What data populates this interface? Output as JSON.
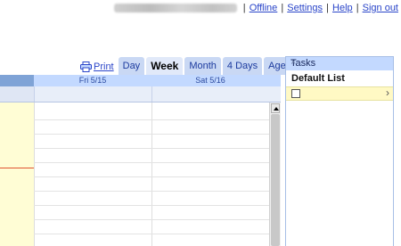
{
  "toplinks": {
    "offline": "Offline",
    "settings": "Settings",
    "help": "Help",
    "signout": "Sign out",
    "separator": "|"
  },
  "viewbar": {
    "print": "Print",
    "tabs": [
      {
        "label": "Day"
      },
      {
        "label": "Week",
        "active": true
      },
      {
        "label": "Month"
      },
      {
        "label": "4 Days"
      },
      {
        "label": "Agenda"
      }
    ]
  },
  "calendar": {
    "days": [
      "Fri 5/15",
      "Sat 5/16"
    ]
  },
  "tasks": {
    "title": "Tasks",
    "close": "×",
    "list_name": "Default List",
    "chevron": "›"
  },
  "colors": {
    "link": "#2a45c9",
    "header_blue": "#c3d9ff",
    "time_column": "#fffdd5",
    "now_line": "#e0522f"
  },
  "icons": [
    "printer-icon",
    "close-icon",
    "chevron-right-icon",
    "checkbox-icon"
  ]
}
